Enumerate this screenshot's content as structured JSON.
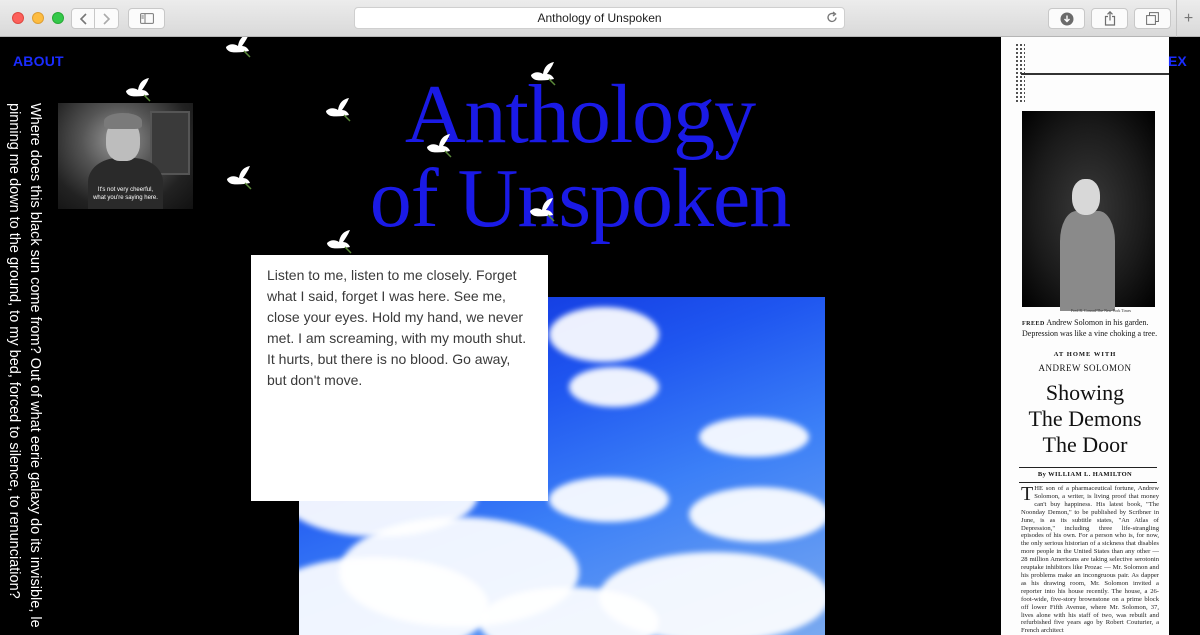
{
  "browser": {
    "title": "Anthology of Unspoken",
    "new_tab_symbol": "+"
  },
  "nav": {
    "about": "ABOUT",
    "index_partial": "EX"
  },
  "side_quote": "Where does this black sun come from? Out of what eerie galaxy do its invisible, le pinning me down to the ground, to my bed, forced to silence, to renunciation?",
  "video": {
    "caption_line1": "It's not very cheerful,",
    "caption_line2": "what you're saying here."
  },
  "title": {
    "line1": "Anthology",
    "line2": "of Unspoken"
  },
  "text_card": "Listen to me, listen to me closely. Forget what I said, forget I was here. See me, close your eyes. Hold my hand, we never met. I am screaming, with my mouth shut. It hurts, but there is no blood. Go away, but don't move.",
  "clipping": {
    "credit": "Fred R. Conrad/The New York Times",
    "caption_label": "FREED",
    "caption": "Andrew Solomon in his garden. Depression was like a vine choking a tree.",
    "kicker": "AT HOME WITH",
    "subject": "ANDREW SOLOMON",
    "headline_line1": "Showing",
    "headline_line2": "The Demons",
    "headline_line3": "The Door",
    "byline": "By WILLIAM L. HAMILTON",
    "body": "THE son of a pharmaceutical fortune, Andrew Solomon, a writer, is living proof that money can't buy happiness. His latest book, \"The Noonday Demon,\" to be published by Scribner in June, is as its subtitle states, \"An Atlas of Depression,\" including three life-strangling episodes of his own. For a person who is, for now, the only serious historian of a sickness that disables more people in the United States than any other — 28 million Americans are taking selective serotonin reuptake inhibitors like Prozac — Mr. Solomon and his problems make an incongruous pair. As dapper as his drawing room, Mr. Solomon invited a reporter into his house recently. The house, a 26-foot-wide, five-story brownstone on a prime block off lower Fifth Avenue, where Mr. Solomon, 37, lives alone with his staff of two, was rebuilt and refurbished five years ago by Robert Couturier, a French architect"
  },
  "colors": {
    "accent_blue": "#1a2cff",
    "title_blue": "#1a1ae6",
    "background": "#000000"
  },
  "icons": [
    "back-icon",
    "forward-icon",
    "sidebar-icon",
    "reload-icon",
    "download-icon",
    "share-icon",
    "tabs-icon",
    "dove-icon"
  ]
}
